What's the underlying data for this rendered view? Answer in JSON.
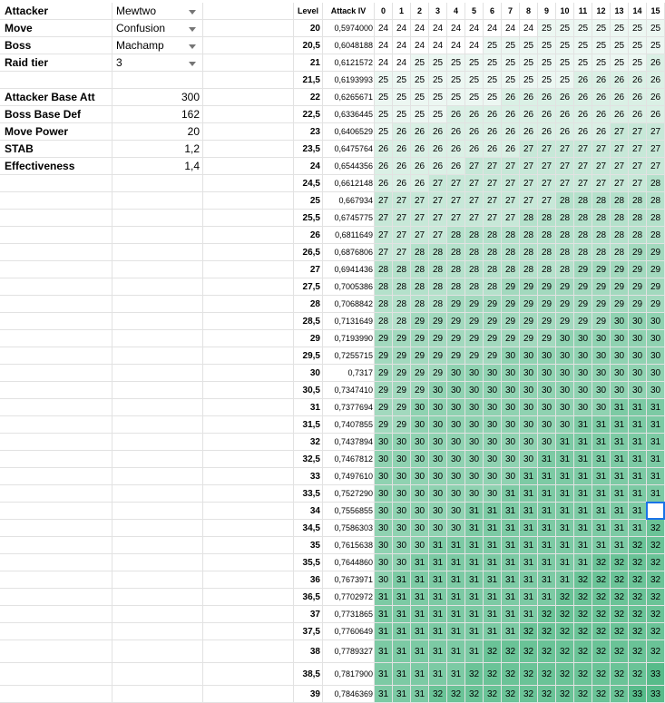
{
  "params": [
    {
      "label": "Attacker",
      "value": "Mewtwo",
      "type": "dropdown"
    },
    {
      "label": "Move",
      "value": "Confusion",
      "type": "dropdown"
    },
    {
      "label": "Boss",
      "value": "Machamp",
      "type": "dropdown"
    },
    {
      "label": "Raid tier",
      "value": "3",
      "type": "dropdown"
    },
    {
      "label": "",
      "value": "",
      "type": "blank"
    },
    {
      "label": "Attacker Base Att",
      "value": "300",
      "type": "number"
    },
    {
      "label": "Boss Base Def",
      "value": "162",
      "type": "number"
    },
    {
      "label": "Move Power",
      "value": "20",
      "type": "number"
    },
    {
      "label": "STAB",
      "value": "1,2",
      "type": "number"
    },
    {
      "label": "Effectiveness",
      "value": "1,4",
      "type": "number"
    }
  ],
  "table": {
    "level_header": "Level",
    "iv_header": "Attack IV",
    "iv_columns": [
      "0",
      "1",
      "2",
      "3",
      "4",
      "5",
      "6",
      "7",
      "8",
      "9",
      "10",
      "11",
      "12",
      "13",
      "14",
      "15"
    ],
    "rows": [
      {
        "level": "20",
        "mult": "0,5974000",
        "v": "24 24 24 24 24 24 24 24 24 25 25 25 25 25 25 25"
      },
      {
        "level": "20,5",
        "mult": "0,6048188",
        "v": "24 24 24 24 24 24 25 25 25 25 25 25 25 25 25 25"
      },
      {
        "level": "21",
        "mult": "0,6121572",
        "v": "24 24 25 25 25 25 25 25 25 25 25 25 25 25 25 26"
      },
      {
        "level": "21,5",
        "mult": "0,6193993",
        "v": "25 25 25 25 25 25 25 25 25 25 25 26 26 26 26 26"
      },
      {
        "level": "22",
        "mult": "0,6265671",
        "v": "25 25 25 25 25 25 25 26 26 26 26 26 26 26 26 26"
      },
      {
        "level": "22,5",
        "mult": "0,6336445",
        "v": "25 25 25 25 26 26 26 26 26 26 26 26 26 26 26 26"
      },
      {
        "level": "23",
        "mult": "0,6406529",
        "v": "25 26 26 26 26 26 26 26 26 26 26 26 26 27 27 27"
      },
      {
        "level": "23,5",
        "mult": "0,6475764",
        "v": "26 26 26 26 26 26 26 26 27 27 27 27 27 27 27 27"
      },
      {
        "level": "24",
        "mult": "0,6544356",
        "v": "26 26 26 26 26 27 27 27 27 27 27 27 27 27 27 27"
      },
      {
        "level": "24,5",
        "mult": "0,6612148",
        "v": "26 26 26 27 27 27 27 27 27 27 27 27 27 27 27 28"
      },
      {
        "level": "25",
        "mult": "0,667934",
        "v": "27 27 27 27 27 27 27 27 27 27 28 28 28 28 28 28"
      },
      {
        "level": "25,5",
        "mult": "0,6745775",
        "v": "27 27 27 27 27 27 27 27 28 28 28 28 28 28 28 28"
      },
      {
        "level": "26",
        "mult": "0,6811649",
        "v": "27 27 27 27 28 28 28 28 28 28 28 28 28 28 28 28"
      },
      {
        "level": "26,5",
        "mult": "0,6876806",
        "v": "27 27 28 28 28 28 28 28 28 28 28 28 28 28 29 29"
      },
      {
        "level": "27",
        "mult": "0,6941436",
        "v": "28 28 28 28 28 28 28 28 28 28 28 29 29 29 29 29"
      },
      {
        "level": "27,5",
        "mult": "0,7005386",
        "v": "28 28 28 28 28 28 28 29 29 29 29 29 29 29 29 29"
      },
      {
        "level": "28",
        "mult": "0,7068842",
        "v": "28 28 28 28 29 29 29 29 29 29 29 29 29 29 29 29"
      },
      {
        "level": "28,5",
        "mult": "0,7131649",
        "v": "28 28 29 29 29 29 29 29 29 29 29 29 29 30 30 30"
      },
      {
        "level": "29",
        "mult": "0,7193990",
        "v": "29 29 29 29 29 29 29 29 29 29 30 30 30 30 30 30"
      },
      {
        "level": "29,5",
        "mult": "0,7255715",
        "v": "29 29 29 29 29 29 29 30 30 30 30 30 30 30 30 30"
      },
      {
        "level": "30",
        "mult": "0,7317",
        "v": "29 29 29 29 30 30 30 30 30 30 30 30 30 30 30 30"
      },
      {
        "level": "30,5",
        "mult": "0,7347410",
        "v": "29 29 29 30 30 30 30 30 30 30 30 30 30 30 30 30"
      },
      {
        "level": "31",
        "mult": "0,7377694",
        "v": "29 29 30 30 30 30 30 30 30 30 30 30 30 31 31 31"
      },
      {
        "level": "31,5",
        "mult": "0,7407855",
        "v": "29 29 30 30 30 30 30 30 30 30 30 31 31 31 31 31"
      },
      {
        "level": "32",
        "mult": "0,7437894",
        "v": "30 30 30 30 30 30 30 30 30 30 31 31 31 31 31 31"
      },
      {
        "level": "32,5",
        "mult": "0,7467812",
        "v": "30 30 30 30 30 30 30 30 30 31 31 31 31 31 31 31"
      },
      {
        "level": "33",
        "mult": "0,7497610",
        "v": "30 30 30 30 30 30 30 30 31 31 31 31 31 31 31 31"
      },
      {
        "level": "33,5",
        "mult": "0,7527290",
        "v": "30 30 30 30 30 30 30 31 31 31 31 31 31 31 31 31"
      },
      {
        "level": "34",
        "mult": "0,7556855",
        "v": "30 30 30 30 30 31 31 31 31 31 31 31 31 31 31 "
      },
      {
        "level": "34,5",
        "mult": "0,7586303",
        "v": "30 30 30 30 30 31 31 31 31 31 31 31 31 31 31 32"
      },
      {
        "level": "35",
        "mult": "0,7615638",
        "v": "30 30 30 31 31 31 31 31 31 31 31 31 31 31 32 32"
      },
      {
        "level": "35,5",
        "mult": "0,7644860",
        "v": "30 30 31 31 31 31 31 31 31 31 31 31 32 32 32 32"
      },
      {
        "level": "36",
        "mult": "0,7673971",
        "v": "30 31 31 31 31 31 31 31 31 31 31 32 32 32 32 32"
      },
      {
        "level": "36,5",
        "mult": "0,7702972",
        "v": "31 31 31 31 31 31 31 31 31 31 32 32 32 32 32 32"
      },
      {
        "level": "37",
        "mult": "0,7731865",
        "v": "31 31 31 31 31 31 31 31 31 32 32 32 32 32 32 32"
      },
      {
        "level": "37,5",
        "mult": "0,7760649",
        "v": "31 31 31 31 31 31 31 31 32 32 32 32 32 32 32 32"
      },
      {
        "level": "38",
        "mult": "0,7789327",
        "v": "31 31 31 31 31 31 32 32 32 32 32 32 32 32 32 32"
      },
      {
        "level": "38,5",
        "mult": "0,7817900",
        "v": "31 31 31 31 31 32 32 32 32 32 32 32 32 32 32 33"
      },
      {
        "level": "39",
        "mult": "0,7846369",
        "v": "31 31 31 32 32 32 32 32 32 32 32 32 32 32 33 33"
      }
    ],
    "selected_cell": {
      "row": 28,
      "col": 15
    },
    "color_scale": {
      "low": "#ffffff",
      "high": "#57bb8a",
      "min": 24,
      "max": 33
    }
  },
  "colors": {
    "grid": "#e2e2e2",
    "selection": "#1a73e8",
    "dropdown_arrow": "#757575"
  }
}
